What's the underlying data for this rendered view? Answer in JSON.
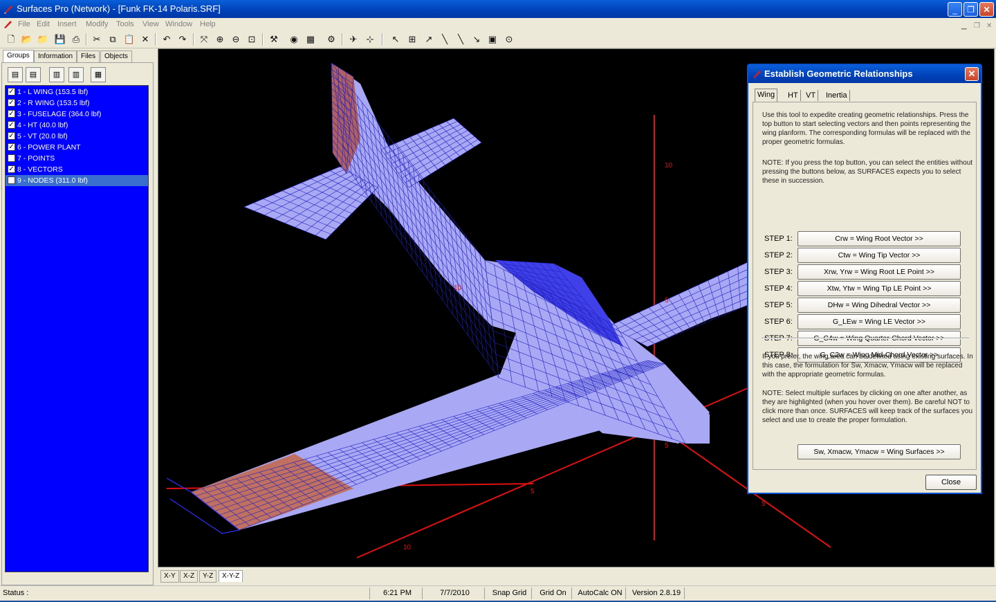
{
  "window": {
    "title": "Surfaces Pro (Network) - [Funk FK-14 Polaris.SRF]",
    "minimize": "_",
    "restore": "❐",
    "close": "✕"
  },
  "menu": [
    "File",
    "Edit",
    "Insert",
    "Modify",
    "Tools",
    "View",
    "Window",
    "Help"
  ],
  "left_tabs": [
    "Groups",
    "Information",
    "Files",
    "Objects"
  ],
  "groups": [
    {
      "label": "1 - L WING (153.5 lbf)",
      "checked": true
    },
    {
      "label": "2 - R WING (153.5 lbf)",
      "checked": true
    },
    {
      "label": "3 - FUSELAGE (364.0 lbf)",
      "checked": true
    },
    {
      "label": "4 - HT (40.0 lbf)",
      "checked": true
    },
    {
      "label": "5 - VT (20.0 lbf)",
      "checked": true
    },
    {
      "label": "6 - POWER PLANT",
      "checked": true
    },
    {
      "label": "7 - POINTS",
      "checked": false
    },
    {
      "label": "8 - VECTORS",
      "checked": true
    },
    {
      "label": "9 - NODES (311.0 lbf)",
      "checked": false
    }
  ],
  "view_tabs": [
    "X-Y",
    "X-Z",
    "Y-Z",
    "X-Y-Z"
  ],
  "axis_labels": {
    "a": "10",
    "b": "10",
    "c": "5",
    "d": "10",
    "e": "5",
    "f": "5",
    "g": "5"
  },
  "status": {
    "status_label": "Status :",
    "time": "6:21 PM",
    "date": "7/7/2010",
    "snap": "Snap Grid",
    "grid": "Grid On",
    "autocalc": "AutoCalc ON",
    "version": "Version 2.8.19"
  },
  "dialog": {
    "title": "Establish Geometric Relationships",
    "tabs": [
      "Wing",
      "HT",
      "VT",
      "Inertia"
    ],
    "intro": "Use this tool to expedite creating geometric relationships. Press the top button to start selecting vectors and then points representing the wing planform. The corresponding formulas will be replaced with the proper geometric formulas.",
    "note1": "NOTE: If you press the top button, you can select the entities without pressing the buttons below, as SURFACES expects you to select these in succession.",
    "steps": [
      {
        "label": "STEP 1:",
        "button": "Crw = Wing Root Vector >>"
      },
      {
        "label": "STEP 2:",
        "button": "Ctw = Wing Tip Vector >>"
      },
      {
        "label": "STEP 3:",
        "button": "Xrw, Yrw = Wing Root LE Point >>"
      },
      {
        "label": "STEP 4:",
        "button": "Xtw, Ytw = Wing Tip LE Point >>"
      },
      {
        "label": "STEP 5:",
        "button": "DHw = Wing Dihedral Vector >>"
      },
      {
        "label": "STEP 6:",
        "button": "G_LEw = Wing LE Vector >>"
      },
      {
        "label": "STEP 7:",
        "button": "G_C4w = Wing Quarter-Chord Vector >>"
      },
      {
        "label": "STEP 8:",
        "button": "G_C2w = Wing Mid-Chord Vector >>"
      }
    ],
    "prefer": "If you prefer, the wing area can be defined using existing surfaces. In this case, the formulation for Sw, Xmacw, Ymacw will be replaced with the appropriate geometric formulas.",
    "note2": "NOTE: Select multiple surfaces by clicking on one after another, as they are highlighted (when you hover over them). Be careful NOT to click more than once. SURFACES will keep track of the surfaces you select and use to create the proper formulation.",
    "surfaces_button": "Sw, Xmacw, Ymacw = Wing Surfaces >>",
    "close_button": "Close"
  }
}
